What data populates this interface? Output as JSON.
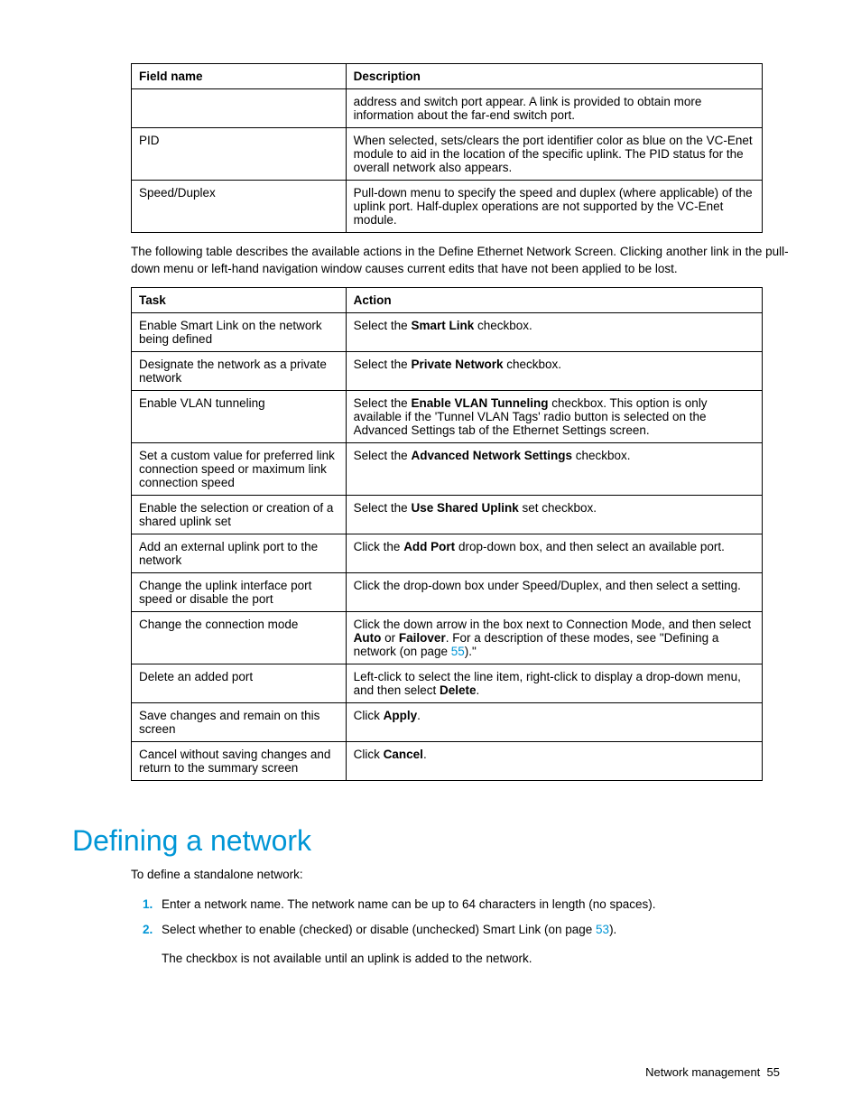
{
  "table1": {
    "headers": {
      "c1": "Field name",
      "c2": "Description"
    },
    "rows": [
      {
        "c1": "",
        "c2": "address and switch port appear. A link is provided to obtain more information about the far-end switch port."
      },
      {
        "c1": "PID",
        "c2": "When selected, sets/clears the port identifier color as blue on the VC-Enet module to aid in the location of the specific uplink. The PID status for the overall network also appears."
      },
      {
        "c1": "Speed/Duplex",
        "c2": "Pull-down menu to specify the speed and duplex (where applicable) of the uplink port. Half-duplex operations are not supported by the VC-Enet module."
      }
    ]
  },
  "para1": "The following table describes the available actions in the Define Ethernet Network Screen. Clicking another link in the pull-down menu or left-hand navigation window causes current edits that have not been applied to be lost.",
  "table2": {
    "headers": {
      "c1": "Task",
      "c2": "Action"
    },
    "rows": [
      {
        "c1": "Enable Smart Link on the network being defined",
        "pre": "Select the ",
        "bold": "Smart Link",
        "post": " checkbox."
      },
      {
        "c1": "Designate the network as a private network",
        "pre": "Select the ",
        "bold": "Private Network",
        "post": " checkbox."
      },
      {
        "c1": "Enable VLAN tunneling",
        "pre": "Select the ",
        "bold": "Enable VLAN Tunneling",
        "post": " checkbox. This option is only available if the 'Tunnel VLAN Tags' radio button is selected on the Advanced Settings tab of the Ethernet Settings screen."
      },
      {
        "c1": "Set a custom value for preferred link connection speed or maximum link connection speed",
        "pre": "Select the ",
        "bold": "Advanced Network Settings",
        "post": " checkbox."
      },
      {
        "c1": "Enable the selection or creation of a shared uplink set",
        "pre": "Select the ",
        "bold": "Use Shared Uplink",
        "post": " set checkbox."
      },
      {
        "c1": "Add an external uplink port to the network",
        "pre": "Click the ",
        "bold": "Add Port",
        "post": " drop-down box, and then select an available port."
      },
      {
        "c1": "Change the uplink interface port speed or disable the port",
        "plain": "Click the drop-down box under Speed/Duplex, and then select a setting."
      },
      {
        "c1": "Change the connection mode",
        "custom_mode": true,
        "t1": "Click the down arrow in the box next to Connection Mode, and then select ",
        "b1": "Auto",
        "t2": " or ",
        "b2": "Failover",
        "t3": ". For a description of these modes, see \"Defining a network (on page ",
        "link": "55",
        "t4": ").\""
      },
      {
        "c1": "Delete an added port",
        "t1": "Left-click to select the line item, right-click to display a drop-down menu, and then select ",
        "bold": "Delete",
        "post": "."
      },
      {
        "c1": "Save changes and remain on this screen",
        "pre": "Click ",
        "bold": "Apply",
        "post": "."
      },
      {
        "c1": "Cancel without saving changes and return to the summary screen",
        "pre": "Click ",
        "bold": "Cancel",
        "post": "."
      }
    ]
  },
  "section_title": "Defining a network",
  "intro2": "To define a standalone network:",
  "steps": {
    "s1": "Enter a network name. The network name can be up to 64 characters in length (no spaces).",
    "s2_pre": "Select whether to enable (checked) or disable (unchecked) Smart Link (on page ",
    "s2_link": "53",
    "s2_post": ").",
    "s2_sub": "The checkbox is not available until an uplink is added to the network."
  },
  "footer": {
    "text": "Network management",
    "page": "55"
  }
}
